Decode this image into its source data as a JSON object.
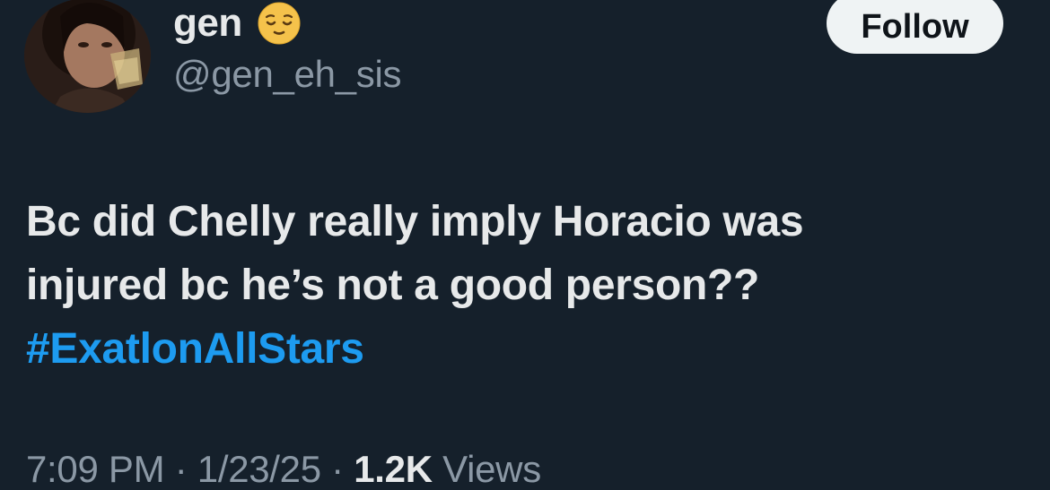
{
  "user": {
    "display_name": "gen",
    "emoji": "relieved-face-emoji",
    "handle": "@gen_eh_sis",
    "avatar": "profile-photo"
  },
  "follow_button": {
    "label": "Follow"
  },
  "tweet": {
    "text_line_1": "Bc did Chelly really imply Horacio was",
    "text_line_2": "injured bc he’s not a good person??",
    "hashtag": "#ExatlonAllStars"
  },
  "meta": {
    "time": "7:09 PM",
    "separator": "·",
    "date": "1/23/25",
    "views_count": "1.2K",
    "views_label": "Views"
  },
  "colors": {
    "background": "#15202b",
    "primary_text": "#e7e9ea",
    "secondary_text": "#8b98a5",
    "link": "#1d9bf0",
    "button_bg": "#eff3f4"
  }
}
